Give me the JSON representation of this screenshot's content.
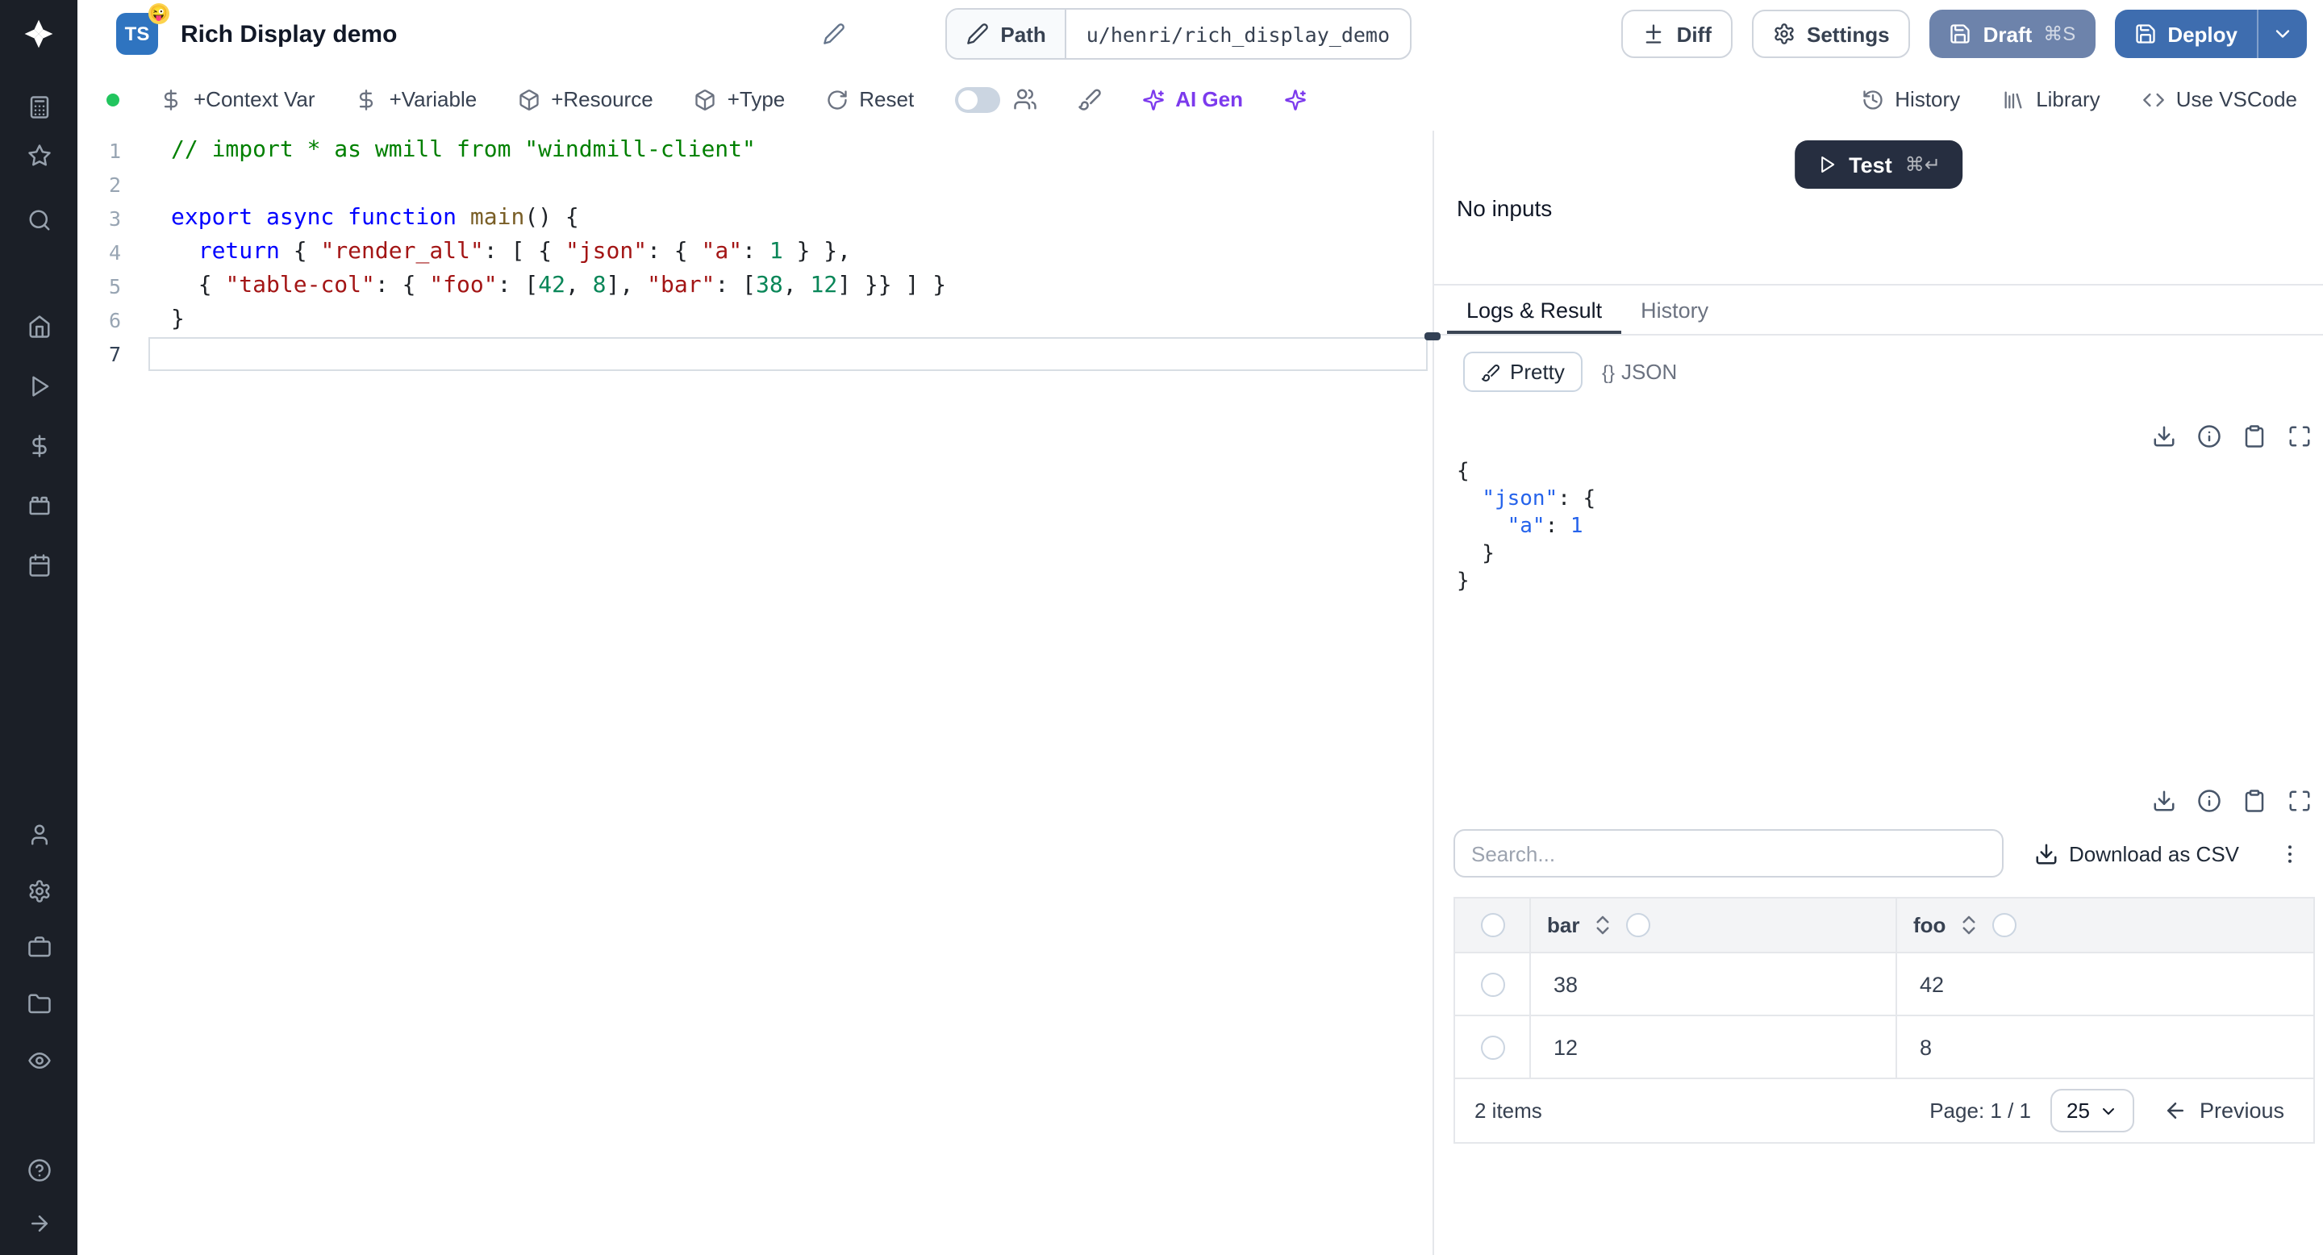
{
  "window": {
    "title": "Rich Display demo",
    "lang_badge": "TS",
    "emoji_badge": "😜"
  },
  "header": {
    "path_label": "Path",
    "path_value": "u/henri/rich_display_demo",
    "diff_label": "Diff",
    "settings_label": "Settings",
    "draft_label": "Draft",
    "draft_shortcut": "⌘S",
    "deploy_label": "Deploy"
  },
  "toolbar": {
    "add_context_var": "+Context Var",
    "add_variable": "+Variable",
    "add_resource": "+Resource",
    "add_type": "+Type",
    "reset": "Reset",
    "ai_gen": "AI Gen",
    "history": "History",
    "library": "Library",
    "use_vscode": "Use VSCode"
  },
  "editor": {
    "lines": [
      {
        "n": "1",
        "tokens": [
          {
            "c": "cm",
            "t": "// import * as wmill from \"windmill-client\""
          }
        ]
      },
      {
        "n": "2",
        "tokens": []
      },
      {
        "n": "3",
        "tokens": [
          {
            "c": "kw",
            "t": "export async function "
          },
          {
            "c": "fn",
            "t": "main"
          },
          {
            "c": "pl",
            "t": "() {"
          }
        ]
      },
      {
        "n": "4",
        "tokens": [
          {
            "c": "pl",
            "t": "  "
          },
          {
            "c": "kw",
            "t": "return"
          },
          {
            "c": "pl",
            "t": " { "
          },
          {
            "c": "st",
            "t": "\"render_all\""
          },
          {
            "c": "pl",
            "t": ": [ { "
          },
          {
            "c": "st",
            "t": "\"json\""
          },
          {
            "c": "pl",
            "t": ": { "
          },
          {
            "c": "st",
            "t": "\"a\""
          },
          {
            "c": "pl",
            "t": ": "
          },
          {
            "c": "nu",
            "t": "1"
          },
          {
            "c": "pl",
            "t": " } },"
          }
        ]
      },
      {
        "n": "5",
        "tokens": [
          {
            "c": "pl",
            "t": "  { "
          },
          {
            "c": "st",
            "t": "\"table-col\""
          },
          {
            "c": "pl",
            "t": ": { "
          },
          {
            "c": "st",
            "t": "\"foo\""
          },
          {
            "c": "pl",
            "t": ": ["
          },
          {
            "c": "nu",
            "t": "42"
          },
          {
            "c": "pl",
            "t": ", "
          },
          {
            "c": "nu",
            "t": "8"
          },
          {
            "c": "pl",
            "t": "], "
          },
          {
            "c": "st",
            "t": "\"bar\""
          },
          {
            "c": "pl",
            "t": ": ["
          },
          {
            "c": "nu",
            "t": "38"
          },
          {
            "c": "pl",
            "t": ", "
          },
          {
            "c": "nu",
            "t": "12"
          },
          {
            "c": "pl",
            "t": "] }} ] }"
          }
        ]
      },
      {
        "n": "6",
        "tokens": [
          {
            "c": "pl",
            "t": "}"
          }
        ]
      },
      {
        "n": "7",
        "tokens": [],
        "current": true
      }
    ]
  },
  "run_panel": {
    "no_inputs": "No inputs",
    "test_label": "Test",
    "test_shortcut": "⌘↵",
    "tabs": {
      "logs_result": "Logs & Result",
      "history": "History"
    }
  },
  "result": {
    "pretty_label": "Pretty",
    "json_icon": "{}",
    "json_label": "JSON",
    "json_lines": [
      [
        {
          "c": "pl",
          "t": "{"
        }
      ],
      [
        {
          "c": "pl",
          "t": "  "
        },
        {
          "c": "key",
          "t": "\"json\""
        },
        {
          "c": "pl",
          "t": ": {"
        }
      ],
      [
        {
          "c": "pl",
          "t": "    "
        },
        {
          "c": "key",
          "t": "\"a\""
        },
        {
          "c": "pl",
          "t": ": "
        },
        {
          "c": "num",
          "t": "1"
        }
      ],
      [
        {
          "c": "pl",
          "t": "  }"
        }
      ],
      [
        {
          "c": "pl",
          "t": "}"
        }
      ]
    ]
  },
  "table": {
    "search_placeholder": "Search...",
    "download_csv_label": "Download as CSV",
    "columns": [
      "bar",
      "foo"
    ],
    "rows": [
      [
        "38",
        "42"
      ],
      [
        "12",
        "8"
      ]
    ],
    "items_count": "2 items",
    "page_label": "Page: 1 / 1",
    "page_size": "25",
    "previous_label": "Previous"
  },
  "colors": {
    "deploy_blue": "#3e6daf",
    "draft_blue": "#6d83ab",
    "test_dark": "#262e40",
    "ai_violet": "#7c3aed",
    "status_green": "#22c55e"
  },
  "sidebar_icons": [
    "windmill-logo",
    "calculator",
    "star",
    "search",
    "home",
    "play",
    "dollar",
    "toy-brick",
    "calendar",
    "user",
    "settings",
    "briefcase",
    "folder",
    "eye",
    "help-circle",
    "arrow-right"
  ]
}
